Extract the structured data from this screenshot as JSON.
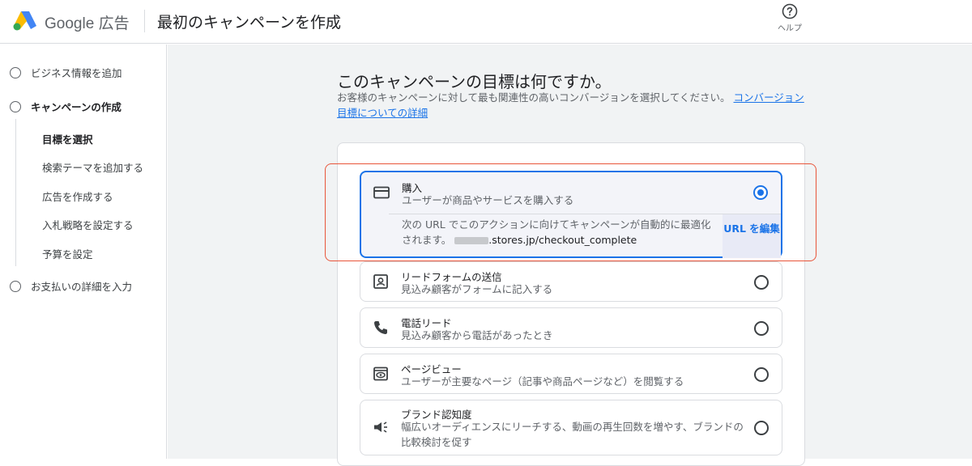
{
  "header": {
    "brand_google": "Google",
    "brand_ads": "広告",
    "page_title": "最初のキャンペーンを作成",
    "help_label": "ヘルプ",
    "help_icon": "help-circle-icon"
  },
  "sidebar": {
    "steps": [
      {
        "label": "ビジネス情報を追加"
      },
      {
        "label": "キャンペーンの作成"
      },
      {
        "label": "お支払いの詳細を入力"
      }
    ],
    "substeps": [
      {
        "label": "目標を選択"
      },
      {
        "label": "検索テーマを追加する"
      },
      {
        "label": "広告を作成する"
      },
      {
        "label": "入札戦略を設定する"
      },
      {
        "label": "予算を設定"
      }
    ]
  },
  "main": {
    "heading": "このキャンペーンの目標は何ですか。",
    "subtext": "お客様のキャンペーンに対して最も関連性の高いコンバージョンを選択してください。",
    "subtext_link": "コンバージョン目標についての詳細",
    "goals": [
      {
        "title": "購入",
        "desc": "ユーザーが商品やサービスを購入する",
        "icon": "credit-card-icon",
        "selected": true,
        "url_note": "次の URL でこのアクションに向けてキャンペーンが自動的に最適化されます。",
        "url_value": ".stores.jp/checkout_complete",
        "url_edit_label": "URL を編集"
      },
      {
        "title": "リードフォームの送信",
        "desc": "見込み顧客がフォームに記入する",
        "icon": "contact-form-icon",
        "selected": false
      },
      {
        "title": "電話リード",
        "desc": "見込み顧客から電話があったとき",
        "icon": "phone-icon",
        "selected": false
      },
      {
        "title": "ページビュー",
        "desc": "ユーザーが主要なページ（記事や商品ページなど）を閲覧する",
        "icon": "page-view-icon",
        "selected": false
      },
      {
        "title": "ブランド認知度",
        "desc": "幅広いオーディエンスにリーチする、動画の再生回数を増やす、ブランドの比較検討を促す",
        "icon": "megaphone-icon",
        "selected": false
      }
    ]
  },
  "colors": {
    "accent": "#1a73e8",
    "highlight_outline": "#e8553a"
  }
}
